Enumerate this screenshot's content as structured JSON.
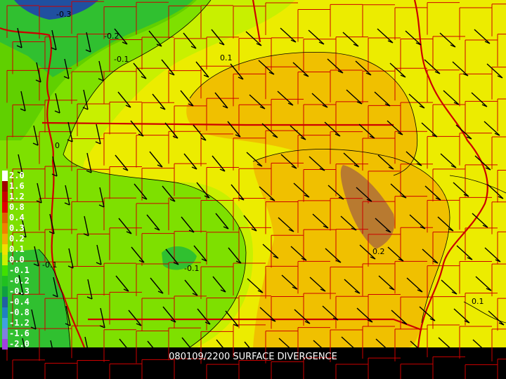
{
  "caption": "080109/2200 SURFACE DIVERGENCE",
  "contour_labels": [
    "-0.3",
    "-0.2",
    "-0.1",
    "0.1",
    "0",
    "-0.1",
    "-0.1",
    "0.2",
    "0.1"
  ],
  "legend": [
    {
      "label": "2.0",
      "color": "#ffffff"
    },
    {
      "label": "1.6",
      "color": "#a00000"
    },
    {
      "label": "1.2",
      "color": "#c80000"
    },
    {
      "label": "0.8",
      "color": "#e00000"
    },
    {
      "label": "0.4",
      "color": "#e06000"
    },
    {
      "label": "0.3",
      "color": "#f08000"
    },
    {
      "label": "0.2",
      "color": "#f0b000"
    },
    {
      "label": "0.1",
      "color": "#f0e000"
    },
    {
      "label": "0.0",
      "color": "#c8f000"
    },
    {
      "label": "-0.1",
      "color": "#40e000"
    },
    {
      "label": "-0.2",
      "color": "#20c020"
    },
    {
      "label": "-0.3",
      "color": "#10a040"
    },
    {
      "label": "-0.4",
      "color": "#2060a0"
    },
    {
      "label": "-0.8",
      "color": "#2080c0"
    },
    {
      "label": "-1.2",
      "color": "#40a0e0"
    },
    {
      "label": "-1.6",
      "color": "#8080e0"
    },
    {
      "label": "-2.0",
      "color": "#a040e0"
    }
  ],
  "colors": {
    "background": "#000000",
    "county_lines": "#cc0000",
    "contours": "#000000",
    "wind_barbs": "#000000",
    "positive_high": "#b87a30",
    "positive_mid": "#f0c000",
    "positive_low": "#ecec00",
    "near_zero": "#c8f000",
    "negative_low": "#60e000",
    "negative_mid": "#30c030",
    "negative_high": "#2050a0"
  }
}
